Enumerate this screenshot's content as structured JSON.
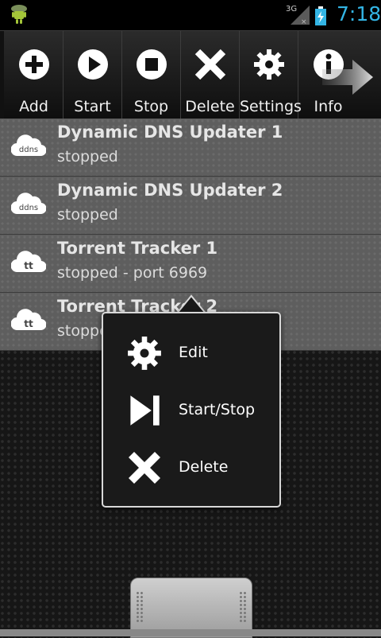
{
  "status_bar": {
    "network": "3G",
    "time": "7:18",
    "accent_color": "#33b5e5"
  },
  "toolbar": {
    "buttons": [
      {
        "label": "Add",
        "icon": "plus-circle-icon"
      },
      {
        "label": "Start",
        "icon": "play-circle-icon"
      },
      {
        "label": "Stop",
        "icon": "stop-circle-icon"
      },
      {
        "label": "Delete",
        "icon": "x-icon"
      },
      {
        "label": "Settings",
        "icon": "gear-icon"
      },
      {
        "label": "Info",
        "icon": "info-circle-icon"
      }
    ],
    "scroll_arrow_icon": "arrow-right-icon"
  },
  "services": [
    {
      "title": "Dynamic DNS Updater 1",
      "status": "stopped",
      "icon": "ddns-cloud-icon",
      "icon_text": "ddns"
    },
    {
      "title": "Dynamic DNS Updater 2",
      "status": "stopped",
      "icon": "ddns-cloud-icon",
      "icon_text": "ddns"
    },
    {
      "title": "Torrent Tracker 1",
      "status": "stopped - port 6969",
      "icon": "tt-cloud-icon",
      "icon_text": "tt"
    },
    {
      "title": "Torrent Tracker 2",
      "status": "stopped",
      "icon": "tt-cloud-icon",
      "icon_text": "tt"
    }
  ],
  "context_menu": {
    "items": [
      {
        "label": "Edit",
        "icon": "gear-icon"
      },
      {
        "label": "Start/Stop",
        "icon": "skip-next-icon"
      },
      {
        "label": "Delete",
        "icon": "x-icon"
      }
    ]
  }
}
